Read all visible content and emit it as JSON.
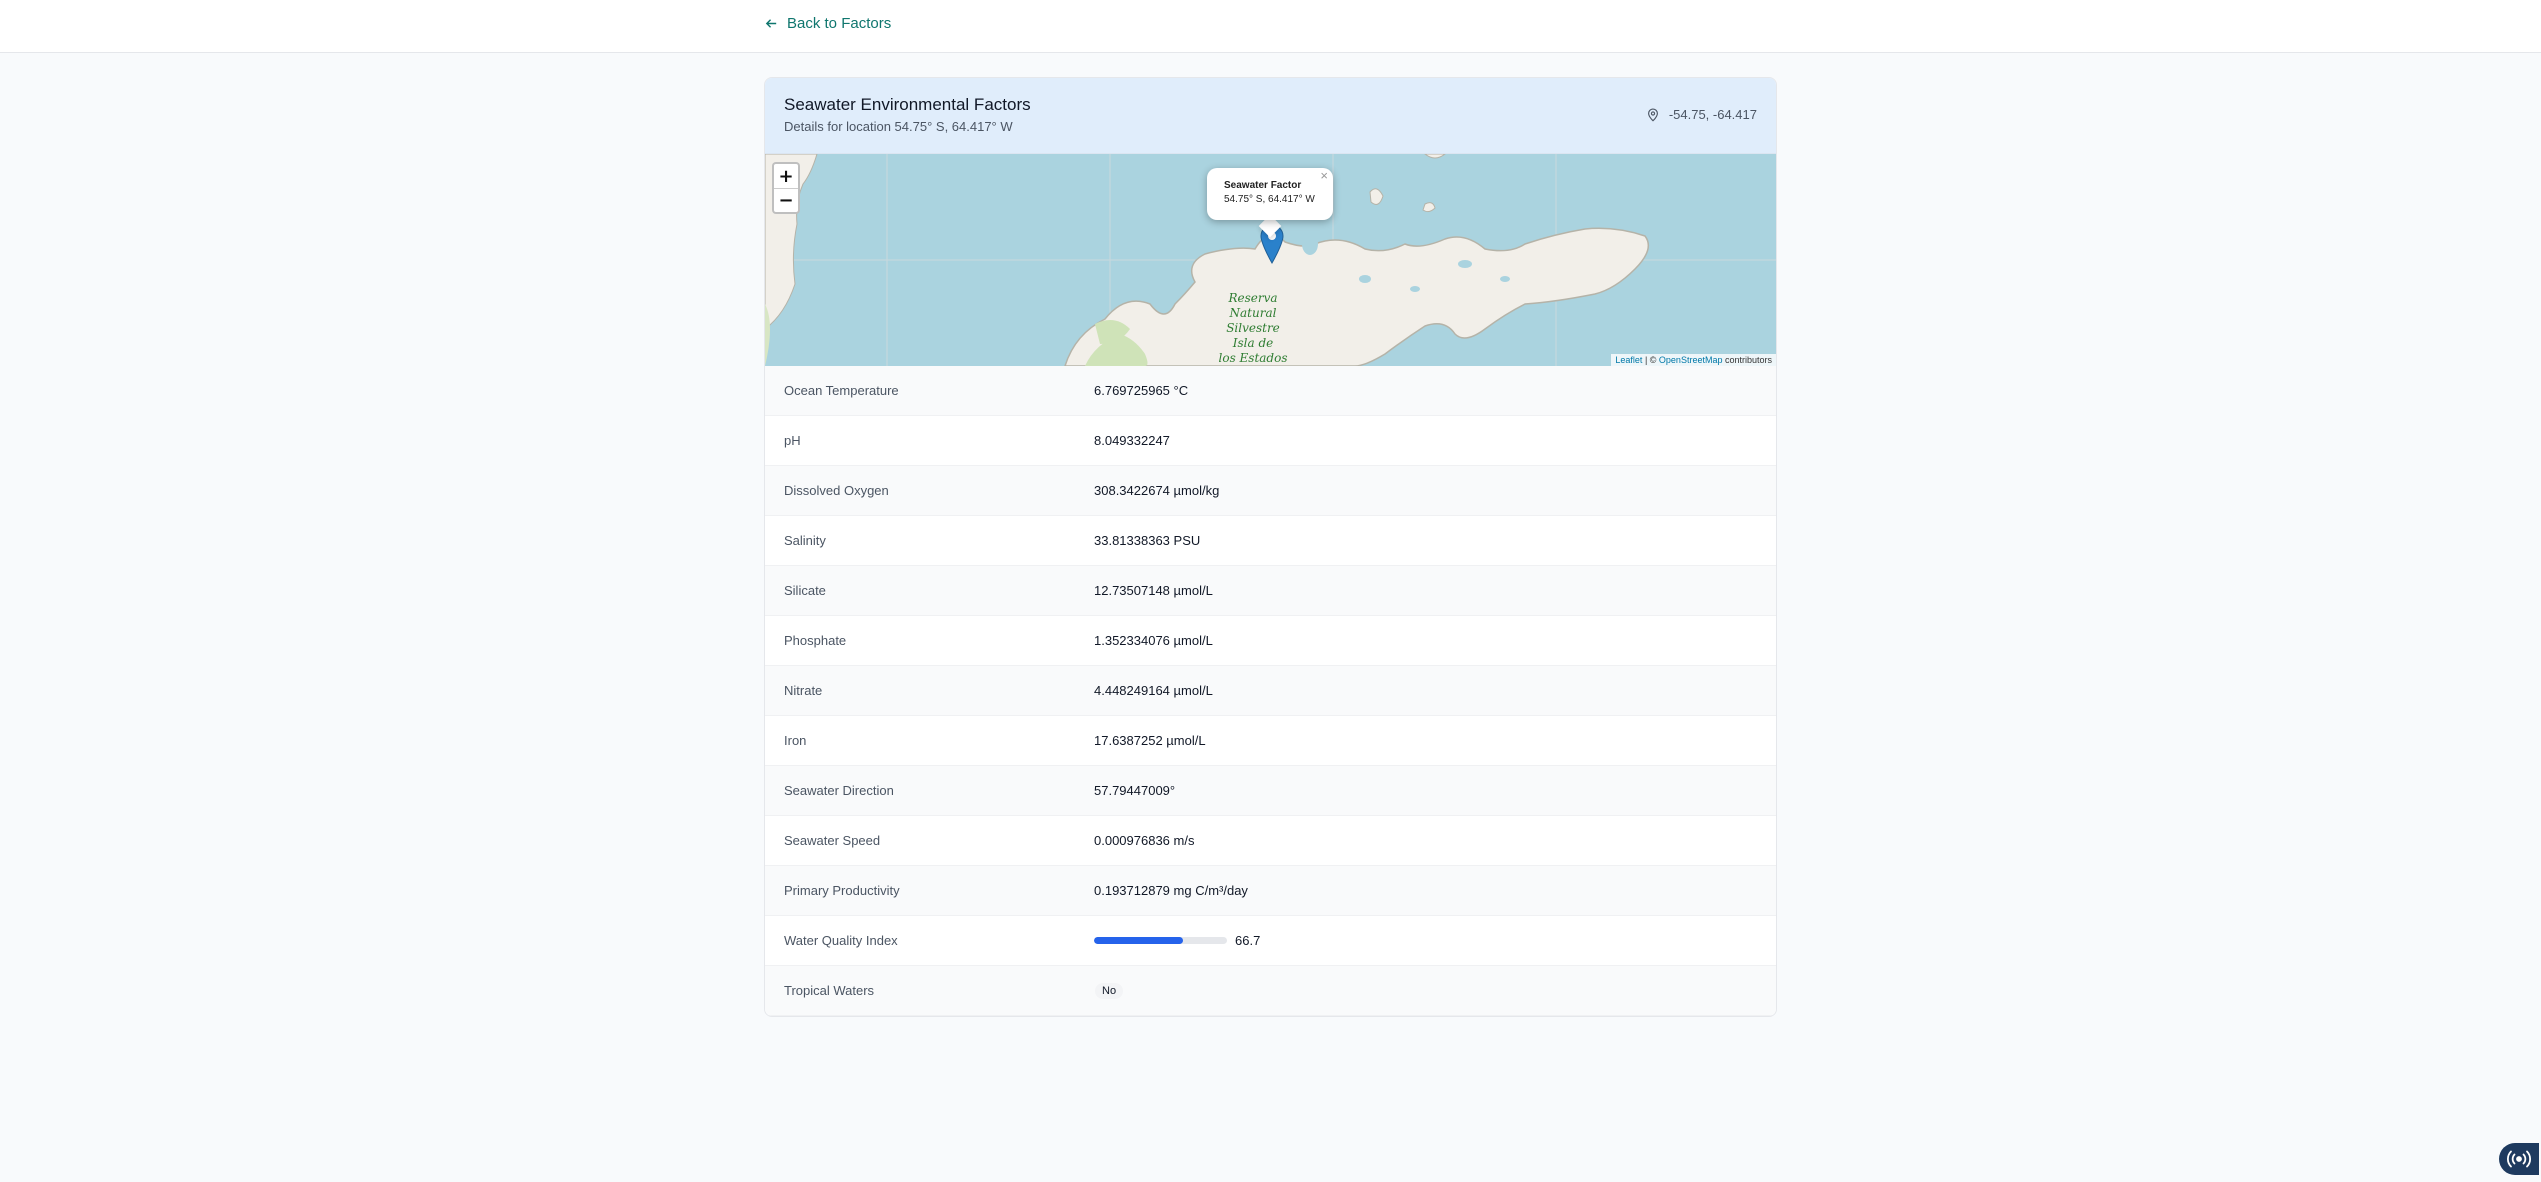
{
  "nav": {
    "back_label": "Back to Factors"
  },
  "header": {
    "title": "Seawater Environmental Factors",
    "subtitle": "Details for location 54.75° S, 64.417° W",
    "coords": "-54.75, -64.417"
  },
  "map": {
    "zoom_in": "+",
    "zoom_out": "−",
    "popup_title": "Seawater Factor",
    "popup_coords": "54.75° S, 64.417° W",
    "popup_close": "×",
    "attr_leaflet": "Leaflet",
    "attr_sep": " | © ",
    "attr_osm": "OpenStreetMap",
    "attr_contrib": " contributors",
    "label_reserve": [
      "Reserva",
      "Natural",
      "Silvestre",
      "Isla de",
      "los Estados"
    ]
  },
  "factors": [
    {
      "label": "Ocean Temperature",
      "value": "6.769725965 °C"
    },
    {
      "label": "pH",
      "value": "8.049332247"
    },
    {
      "label": "Dissolved Oxygen",
      "value": "308.3422674 µmol/kg"
    },
    {
      "label": "Salinity",
      "value": "33.81338363 PSU"
    },
    {
      "label": "Silicate",
      "value": "12.73507148 µmol/L"
    },
    {
      "label": "Phosphate",
      "value": "1.352334076 µmol/L"
    },
    {
      "label": "Nitrate",
      "value": "4.448249164 µmol/L"
    },
    {
      "label": "Iron",
      "value": "17.6387252 µmol/L"
    },
    {
      "label": "Seawater Direction",
      "value": "57.79447009°"
    },
    {
      "label": "Seawater Speed",
      "value": "0.000976836 m/s"
    },
    {
      "label": "Primary Productivity",
      "value": "0.193712879 mg C/m³/day"
    },
    {
      "label": "Water Quality Index",
      "value": "66.7",
      "progress_percent": 66.7
    },
    {
      "label": "Tropical Waters",
      "value": "No"
    }
  ],
  "colors": {
    "accent": "#0f766e",
    "progress": "#2563eb",
    "header_bg": "#e0edfb",
    "water": "#aad3df",
    "land": "#f2efe9",
    "marker": "#2a81cb"
  },
  "icons": {
    "back": "arrow-left-icon",
    "location": "map-pin-icon",
    "fab": "broadcast-icon"
  }
}
